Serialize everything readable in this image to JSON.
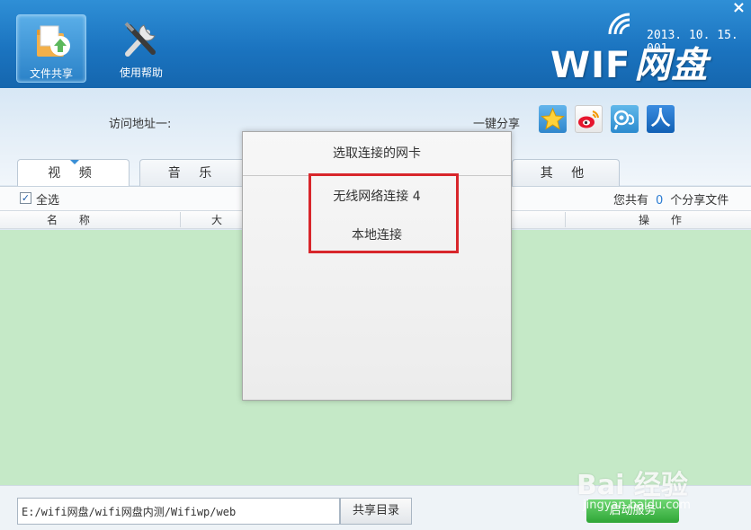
{
  "toolbar": {
    "file_share_label": "文件共享",
    "help_label": "使用帮助"
  },
  "brand": {
    "logo_wifi": "WIF",
    "logo_pan": "网盘",
    "version": "2013. 10. 15. 001"
  },
  "share": {
    "address_label": "访问地址一:",
    "one_click_label": "一键分享",
    "renren_glyph": "人"
  },
  "tabs": [
    {
      "label": "视 频"
    },
    {
      "label": "音 乐"
    },
    {
      "label": "其 他"
    }
  ],
  "list": {
    "select_all_label": "全选",
    "count_prefix": "您共有",
    "count_value": "0",
    "count_suffix": "个分享文件",
    "columns": {
      "name": "名 称",
      "size": "大 小",
      "action": "操 作"
    }
  },
  "footer": {
    "path_value": "E:/wifi网盘/wifi网盘内测/Wifiwp/web",
    "dir_button": "共享目录",
    "start_button": "启动服务"
  },
  "modal": {
    "title": "选取连接的网卡",
    "items": [
      {
        "label": "无线网络连接 4"
      },
      {
        "label": "本地连接"
      }
    ]
  },
  "watermark": {
    "brand": "Bai  经验",
    "url": "jingyan.baidu.com"
  },
  "colors": {
    "header_blue": "#1b74c0",
    "content_green": "#c5e9c7",
    "highlight_red": "#d8262b",
    "count_blue": "#2b7cd3"
  }
}
